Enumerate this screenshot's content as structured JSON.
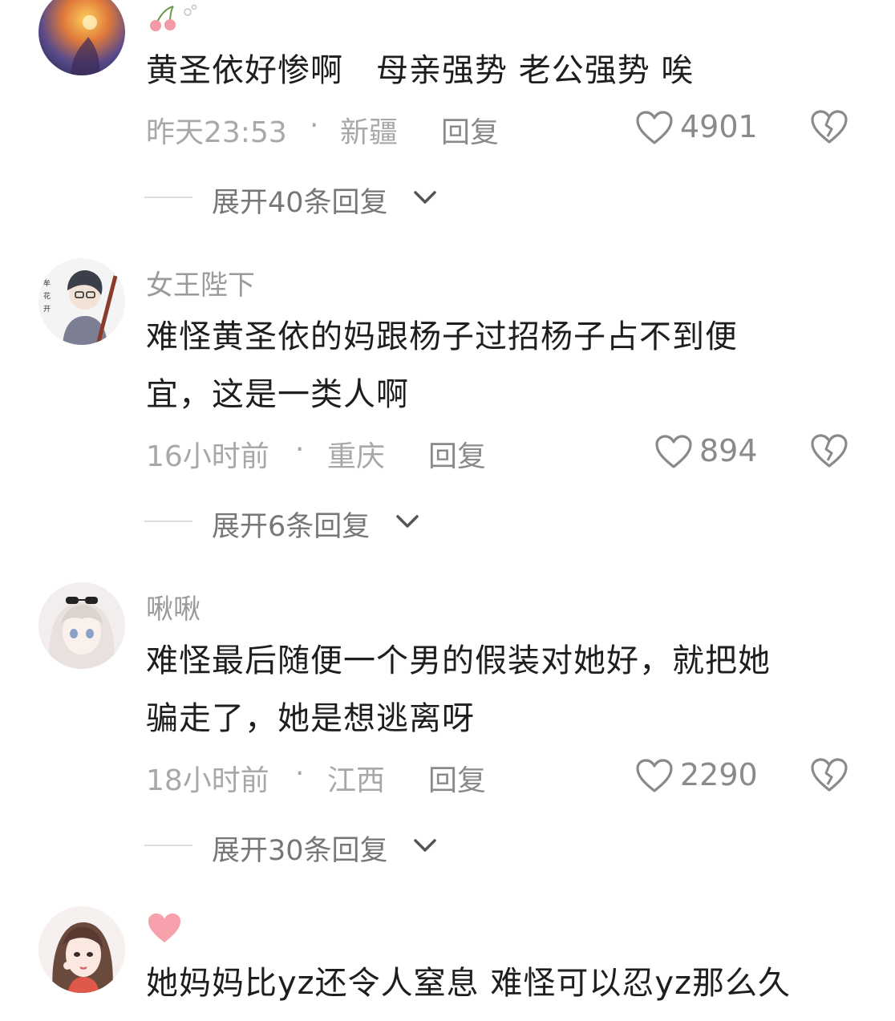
{
  "comments": [
    {
      "avatar_icon": "sunset-portrait-avatar-icon",
      "name": "",
      "name_icon": "cherry-emoji-icon",
      "text": "黄圣依好惨啊　母亲强势  老公强势 唉",
      "time": "昨天23:53",
      "dot": "·",
      "location": "新疆",
      "reply_label": "回复",
      "likes": "4901",
      "expand_label": "展开40条回复"
    },
    {
      "avatar_icon": "guitar-boy-avatar-icon",
      "name": "女王陛下",
      "text_lines": [
        "难怪黄圣依的妈跟杨子过招杨子占不到便",
        "宜，这是一类人啊"
      ],
      "time": "16小时前",
      "dot": "·",
      "location": "重庆",
      "reply_label": "回复",
      "likes": "894",
      "expand_label": "展开6条回复"
    },
    {
      "avatar_icon": "anime-girl-avatar-icon",
      "name": "啾啾",
      "text_lines": [
        "难怪最后随便一个男的假装对她好，就把她",
        "骗走了，她是想逃离呀"
      ],
      "time": "18小时前",
      "dot": "·",
      "location": "江西",
      "reply_label": "回复",
      "likes": "2290",
      "expand_label": "展开30条回复"
    },
    {
      "avatar_icon": "illustrated-girl-avatar-icon",
      "name": "",
      "name_icon": "pink-heart-emoji-icon",
      "text": "她妈妈比yz还令人窒息 难怪可以忍yz那么久"
    }
  ],
  "colors": {
    "text": "#1e1e1e",
    "meta": "#a8a8a8",
    "icon": "#8a8a8a",
    "heart_emoji": "#f7a1ad"
  }
}
